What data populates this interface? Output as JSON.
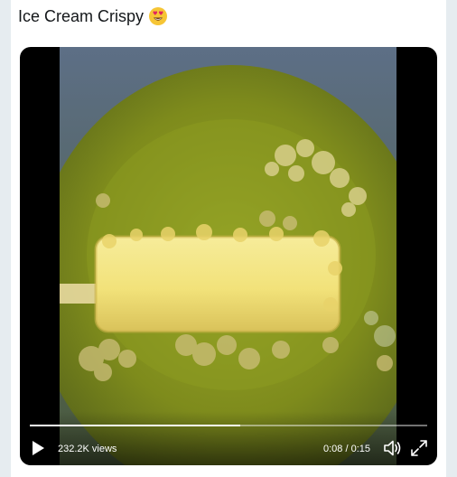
{
  "tweet": {
    "text": "Ice Cream Crispy",
    "emoji": "heart-eyes-emoji"
  },
  "video": {
    "views": "232.2K views",
    "time": "0:08 / 0:15",
    "progress": 0.53
  },
  "icons": {
    "play": "play-icon",
    "volume": "volume-icon",
    "fullscreen": "fullscreen-icon"
  },
  "colors": {
    "oil": "#8a9a1e",
    "food": "#f3e68a"
  }
}
